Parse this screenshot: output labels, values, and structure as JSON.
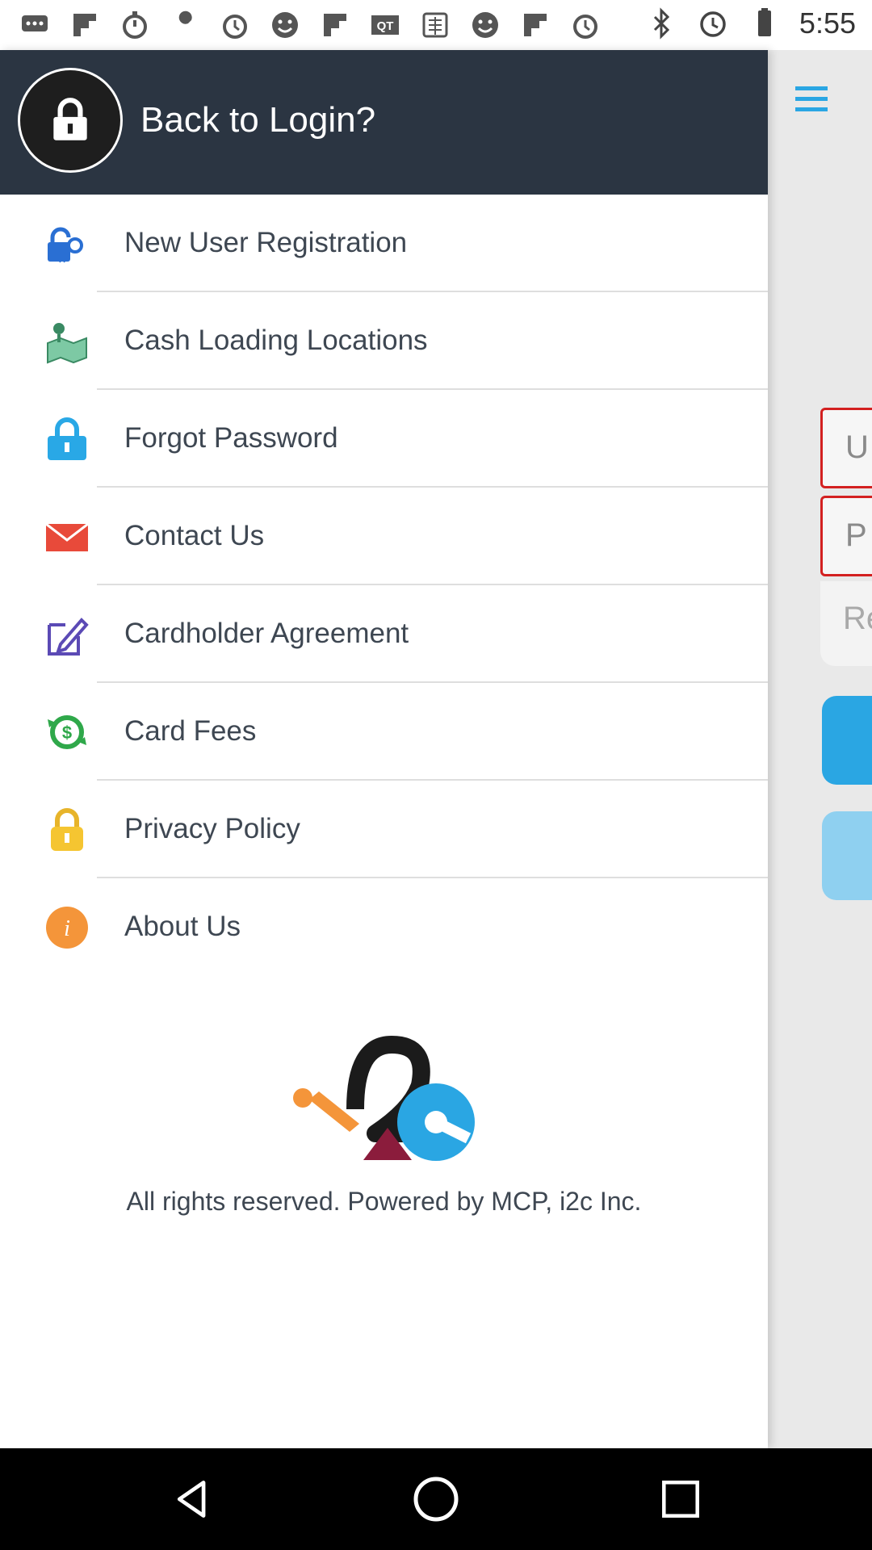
{
  "status_bar": {
    "time": "5:55",
    "notification_icons": [
      "messenger-icon",
      "flipboard-icon",
      "timer-icon",
      "wrench-icon",
      "alarm-icon",
      "smiley-icon",
      "flipboard-icon",
      "qt-icon",
      "chinese-app-icon",
      "smiley-icon",
      "flipboard-icon",
      "alarm-icon"
    ],
    "system_icons": [
      "bluetooth-icon",
      "alarm-clock-icon",
      "battery-icon"
    ]
  },
  "drawer": {
    "header_title": "Back to Login?",
    "items": [
      {
        "label": "New User Registration",
        "icon": "user-key-icon"
      },
      {
        "label": "Cash Loading Locations",
        "icon": "map-pin-icon"
      },
      {
        "label": "Forgot Password",
        "icon": "lock-icon"
      },
      {
        "label": "Contact Us",
        "icon": "envelope-icon"
      },
      {
        "label": "Cardholder Agreement",
        "icon": "edit-document-icon"
      },
      {
        "label": "Card Fees",
        "icon": "money-exchange-icon"
      },
      {
        "label": "Privacy Policy",
        "icon": "padlock-icon"
      },
      {
        "label": "About Us",
        "icon": "info-icon"
      }
    ],
    "footer": "All rights reserved. Powered by MCP, i2c Inc."
  },
  "background_page": {
    "username_placeholder": "U",
    "password_placeholder": "P",
    "remember_text": "Re"
  },
  "colors": {
    "header_bg": "#2b3542",
    "accent_blue": "#2aa6e3",
    "field_border_error": "#d32020"
  }
}
